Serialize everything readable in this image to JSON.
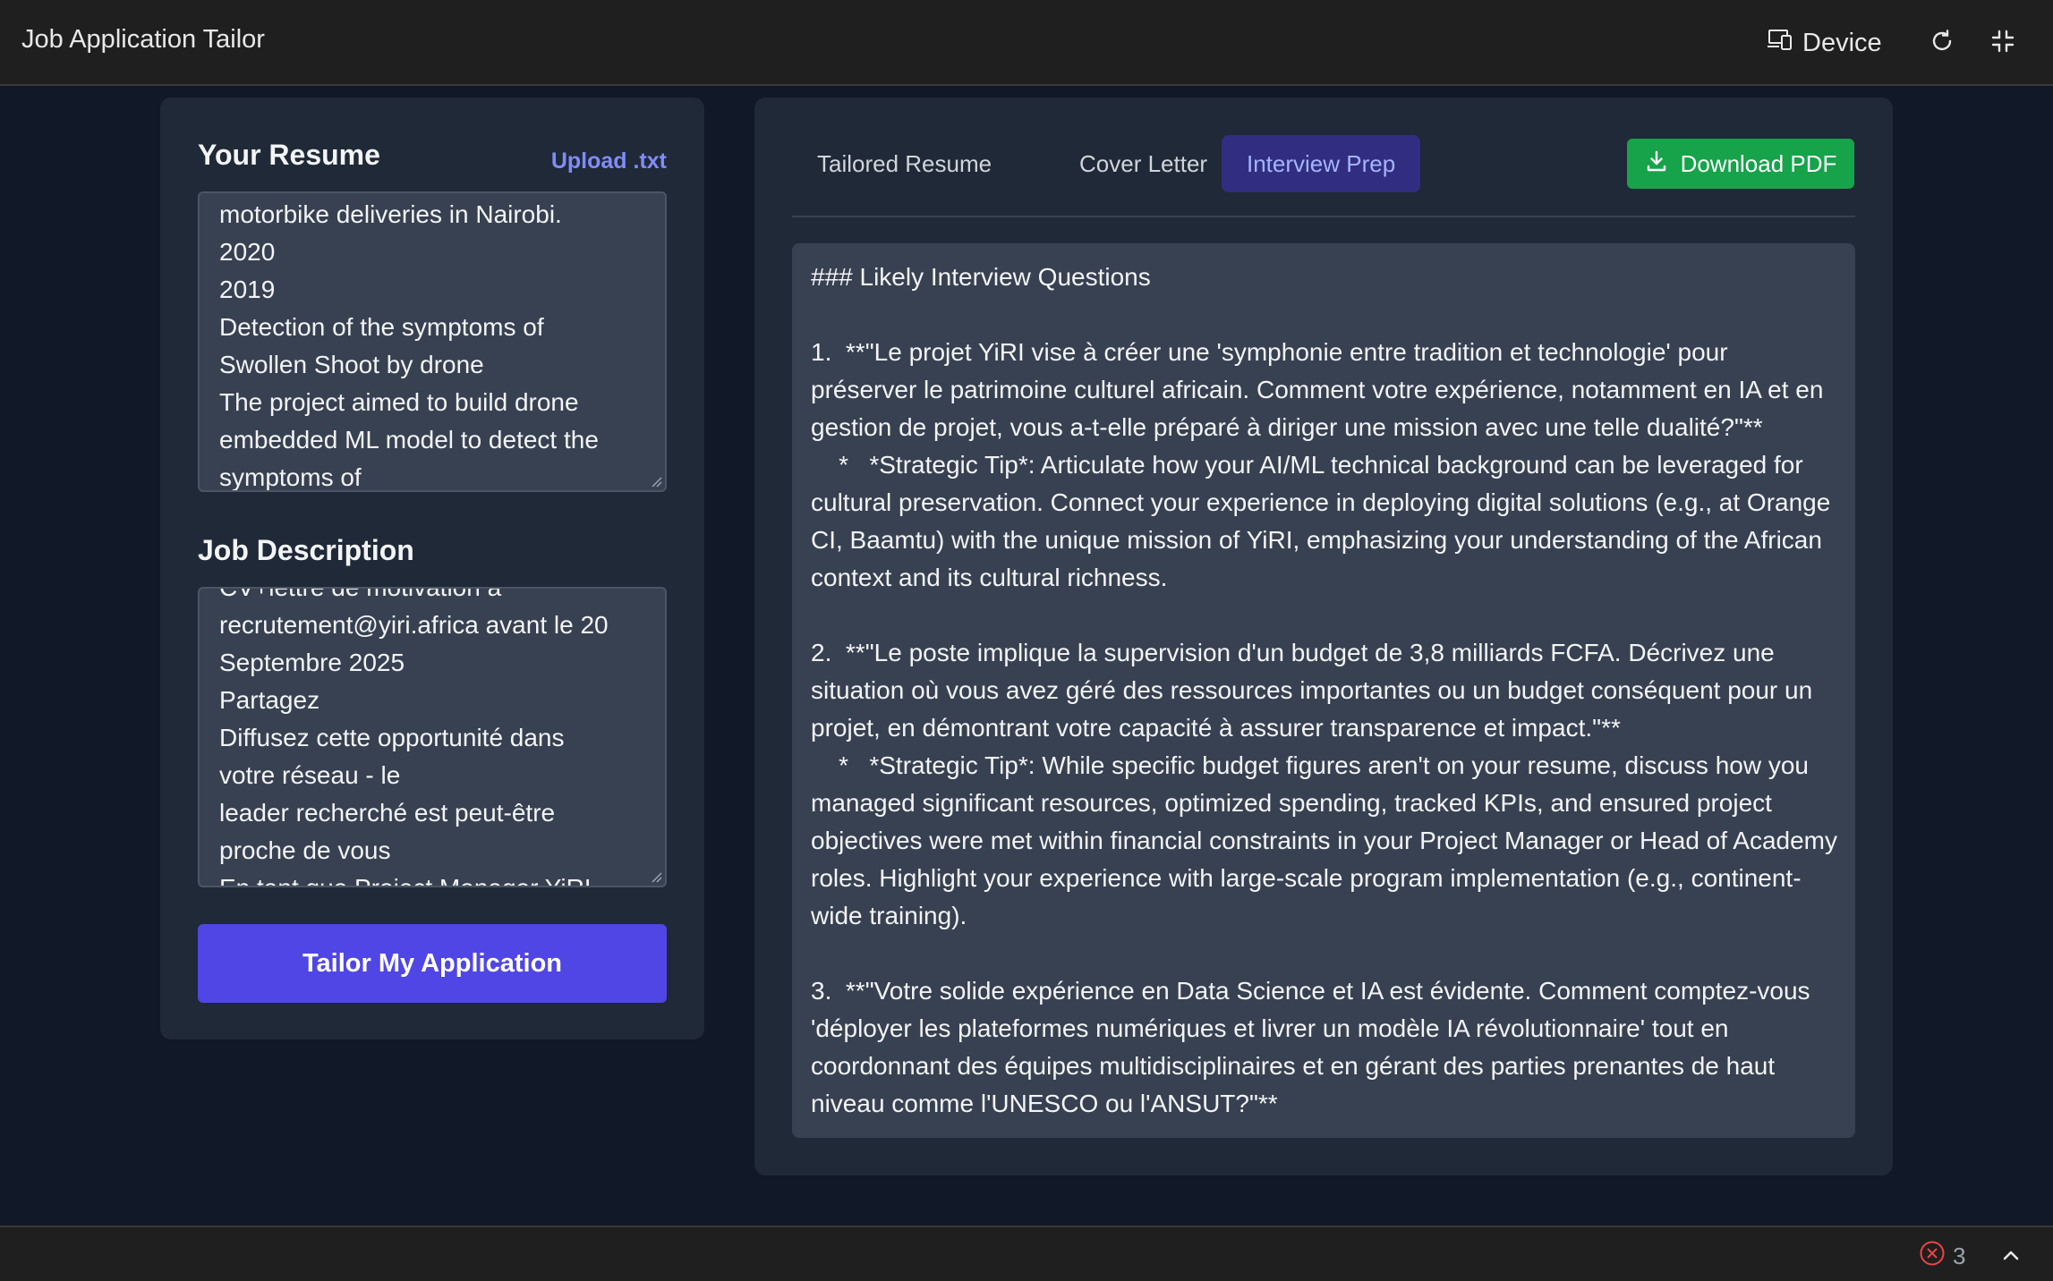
{
  "app": {
    "title": "Job Application Tailor",
    "device_label": "Device"
  },
  "left": {
    "resume_title": "Your Resume",
    "upload_label": "Upload .txt",
    "resume_text": "motorbike deliveries in Nairobi.\n2020\n2019\nDetection of the symptoms of\nSwollen Shoot by drone\nThe project aimed to build drone\nembedded ML model to detect the\nsymptoms of",
    "job_title": "Job Description",
    "job_text": "CV+lettre de motivation à\nrecrutement@yiri.africa avant le 20\nSeptembre 2025\nPartagez\nDiffusez cette opportunité dans\nvotre réseau - le\nleader recherché est peut-être\nproche de vous\nEn tant que Project Manager YiRI",
    "tailor_button": "Tailor My Application"
  },
  "right": {
    "tabs": [
      {
        "label": "Tailored Resume",
        "active": false
      },
      {
        "label": "Cover Letter",
        "active": false
      },
      {
        "label": "Interview Prep",
        "active": true
      }
    ],
    "download_label": "Download PDF",
    "output_text": "### Likely Interview Questions\n\n1.  **\"Le projet YiRI vise à créer une 'symphonie entre tradition et technologie' pour préserver le patrimoine culturel africain. Comment votre expérience, notamment en IA et en gestion de projet, vous a-t-elle préparé à diriger une mission avec une telle dualité?\"**\n    *   *Strategic Tip*: Articulate how your AI/ML technical background can be leveraged for cultural preservation. Connect your experience in deploying digital solutions (e.g., at Orange CI, Baamtu) with the unique mission of YiRI, emphasizing your understanding of the African context and its cultural richness.\n\n2.  **\"Le poste implique la supervision d'un budget de 3,8 milliards FCFA. Décrivez une situation où vous avez géré des ressources importantes ou un budget conséquent pour un projet, en démontrant votre capacité à assurer transparence et impact.\"**\n    *   *Strategic Tip*: While specific budget figures aren't on your resume, discuss how you managed significant resources, optimized spending, tracked KPIs, and ensured project objectives were met within financial constraints in your Project Manager or Head of Academy roles. Highlight your experience with large-scale program implementation (e.g., continent-wide training).\n\n3.  **\"Votre solide expérience en Data Science et IA est évidente. Comment comptez-vous 'déployer les plateformes numériques et livrer un modèle IA révolutionnaire' tout en coordonnant des équipes multidisciplinaires et en gérant des parties prenantes de haut niveau comme l'UNESCO ou l'ANSUT?\"**"
  },
  "status": {
    "error_count": "3"
  },
  "colors": {
    "accent": "#4f46e5",
    "active_tab_bg": "#312e81",
    "active_tab_text": "#a5b4fc",
    "download_green": "#16a34a",
    "error_red": "#ef4444"
  }
}
